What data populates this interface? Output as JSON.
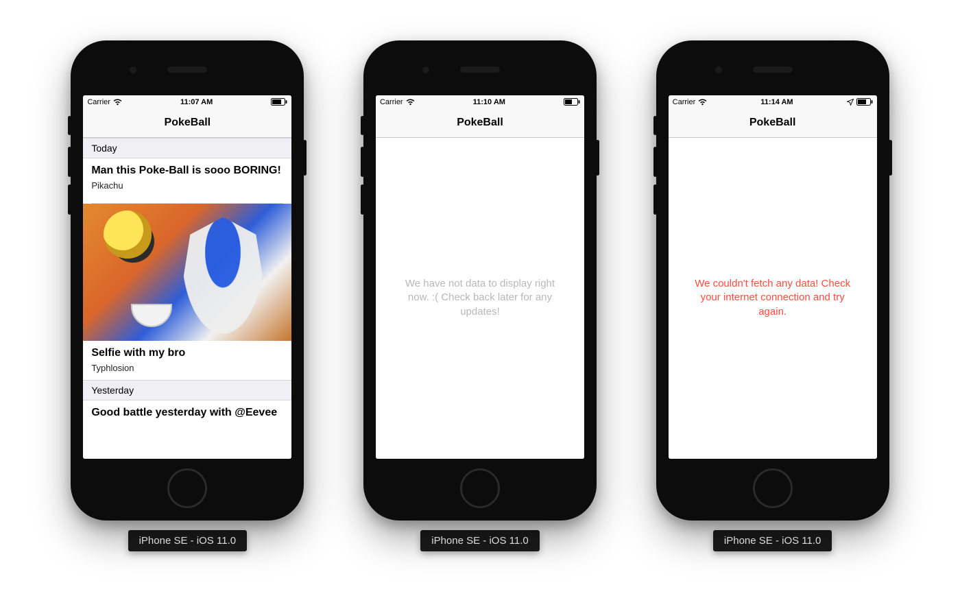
{
  "devices": [
    {
      "label": "iPhone SE - iOS 11.0",
      "status": {
        "carrier": "Carrier",
        "time": "11:07 AM",
        "location": false
      },
      "nav": {
        "title": "PokeBall"
      },
      "mode": "list",
      "sections": [
        {
          "header": "Today",
          "posts": [
            {
              "title": "Man this Poke-Ball is sooo BORING!",
              "author": "Pikachu",
              "has_image": false
            },
            {
              "title": "Selfie with my bro",
              "author": "Typhlosion",
              "has_image": true
            }
          ]
        },
        {
          "header": "Yesterday",
          "posts": [
            {
              "title": "Good battle yesterday with @Eevee",
              "author": "",
              "has_image": false
            }
          ]
        }
      ]
    },
    {
      "label": "iPhone SE - iOS 11.0",
      "status": {
        "carrier": "Carrier",
        "time": "11:10 AM",
        "location": false
      },
      "nav": {
        "title": "PokeBall"
      },
      "mode": "empty",
      "empty_message": "We have not data to display right now. :( Check back later for any updates!"
    },
    {
      "label": "iPhone SE - iOS 11.0",
      "status": {
        "carrier": "Carrier",
        "time": "11:14 AM",
        "location": true
      },
      "nav": {
        "title": "PokeBall"
      },
      "mode": "error",
      "error_message": "We couldn't fetch any data! Check your internet connection and try again."
    }
  ]
}
